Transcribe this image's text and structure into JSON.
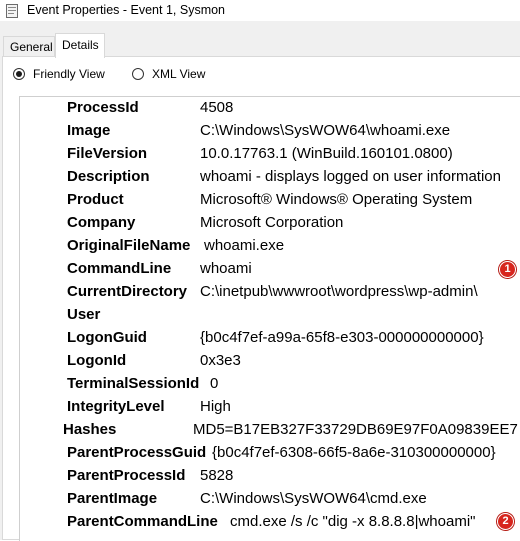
{
  "window": {
    "title": "Event Properties - Event 1, Sysmon"
  },
  "tabs": [
    {
      "label": "General",
      "active": false
    },
    {
      "label": "Details",
      "active": true
    }
  ],
  "view_options": {
    "friendly": {
      "label": "Friendly View",
      "selected": true
    },
    "xml": {
      "label": "XML View",
      "selected": false
    }
  },
  "fields": [
    {
      "key": "ProcessId",
      "value": "4508"
    },
    {
      "key": "Image",
      "value": "C:\\Windows\\SysWOW64\\whoami.exe"
    },
    {
      "key": "FileVersion",
      "value": "10.0.17763.1 (WinBuild.160101.0800)"
    },
    {
      "key": "Description",
      "value": "whoami - displays logged on user information"
    },
    {
      "key": "Product",
      "value": "Microsoft® Windows® Operating System"
    },
    {
      "key": "Company",
      "value": "Microsoft Corporation"
    },
    {
      "key": "OriginalFileName",
      "value": "whoami.exe"
    },
    {
      "key": "CommandLine",
      "value": "whoami"
    },
    {
      "key": "CurrentDirectory",
      "value": "C:\\inetpub\\wwwroot\\wordpress\\wp-admin\\"
    },
    {
      "key": "User",
      "value": ""
    },
    {
      "key": "LogonGuid",
      "value": "{b0c4f7ef-a99a-65f8-e303-000000000000}"
    },
    {
      "key": "LogonId",
      "value": "0x3e3"
    },
    {
      "key": "TerminalSessionId",
      "value": "0"
    },
    {
      "key": "IntegrityLevel",
      "value": "High"
    },
    {
      "key": "Hashes",
      "value": "MD5=B17EB327F33729DB69E97F0A09839EE7"
    },
    {
      "key": "ParentProcessGuid",
      "value": "{b0c4f7ef-6308-66f5-8a6e-310300000000}"
    },
    {
      "key": "ParentProcessId",
      "value": "5828"
    },
    {
      "key": "ParentImage",
      "value": "C:\\Windows\\SysWOW64\\cmd.exe"
    },
    {
      "key": "ParentCommandLine",
      "value": "cmd.exe /s /c \"dig -x 8.8.8.8|whoami\""
    }
  ],
  "annotations": [
    {
      "label": "1",
      "color": "#d7261e"
    },
    {
      "label": "2",
      "color": "#d7261e"
    }
  ]
}
